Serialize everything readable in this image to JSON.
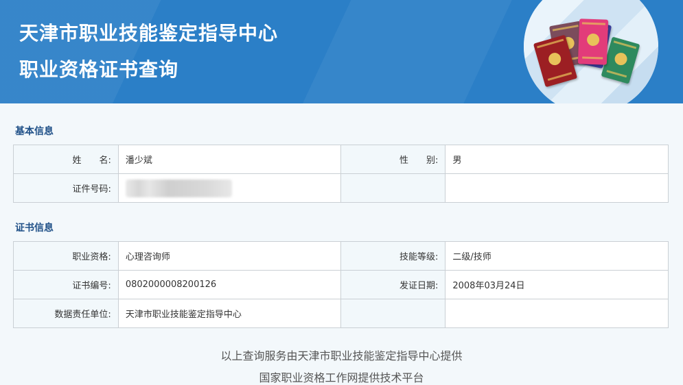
{
  "header": {
    "title_line1": "天津市职业技能鉴定指导中心",
    "title_line2": "职业资格证书查询"
  },
  "sections": {
    "basic_title": "基本信息",
    "cert_title": "证书信息"
  },
  "basic_info": {
    "name_label": "姓　　名:",
    "name_value": "潘少斌",
    "gender_label": "性　　别:",
    "gender_value": "男",
    "id_label": "证件号码:"
  },
  "cert_info": {
    "qualification_label": "职业资格:",
    "qualification_value": "心理咨询师",
    "level_label": "技能等级:",
    "level_value": "二级/技师",
    "cert_no_label": "证书编号:",
    "cert_no_value": "0802000008200126",
    "issue_date_label": "发证日期:",
    "issue_date_value": "2008年03月24日",
    "unit_label": "数据责任单位:",
    "unit_value": "天津市职业技能鉴定指导中心"
  },
  "footer": {
    "line1": "以上查询服务由天津市职业技能鉴定指导中心提供",
    "line2": "国家职业资格工作网提供技术平台"
  },
  "colors": {
    "banner": "#2b7fc7",
    "section_title": "#1e4f87",
    "label_bg": "#f2f8fb",
    "border": "#c9cfd4"
  }
}
